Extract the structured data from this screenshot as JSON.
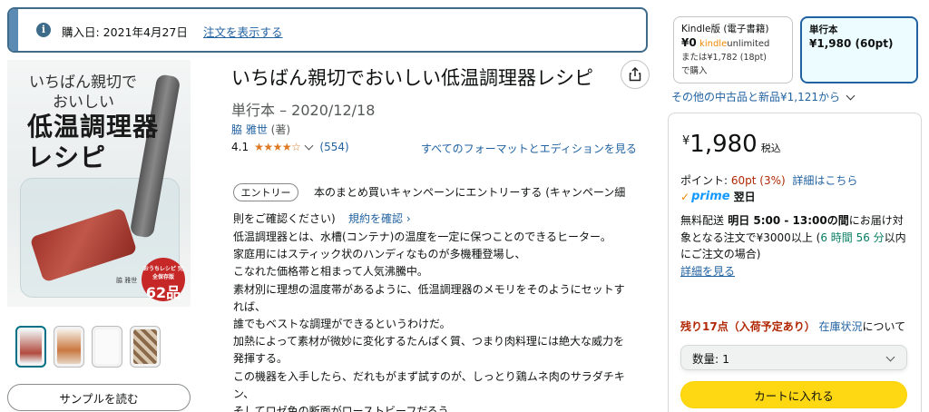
{
  "banner": {
    "purchase_date": "購入日: 2021年4月27日",
    "order_link": "注文を表示する"
  },
  "cover": {
    "line1": "いちばん親切で",
    "line2": "おいしい",
    "line3": "低温調理器",
    "line4": "レシピ",
    "author": "脇 雅世",
    "badge_small": "おうちレシピ 完全保存版",
    "badge_big": "62品"
  },
  "sample_button": "サンプルを読む",
  "product": {
    "title": "いちばん親切でおいしい低温調理器レシピ",
    "subtitle": "単行本 – 2020/12/18",
    "author_name": "脇 雅世",
    "author_role": " (著)",
    "rating": "4.1",
    "stars": "★★★★☆",
    "review_count": "(554)",
    "formats_link": "すべてのフォーマットとエディションを見る"
  },
  "campaign": {
    "entry_button": "エントリー",
    "text_line1": "本のまとめ買いキャンペーンにエントリーする (キャンペーン細",
    "text_line2": "則をご確認ください)",
    "terms_link": "規約を確認 ›"
  },
  "description": [
    "低温調理器とは、水槽(コンテナ)の温度を一定に保つことのできるヒーター。",
    "家庭用にはスティック状のハンディなものが多機種登場し、",
    "こなれた価格帯と相まって人気沸騰中。",
    "素材別に理想の温度帯があるように、低温調理器のメモリをそのようにセットす",
    "れば、",
    "誰でもベストな調理ができるというわけだ。",
    "加熱によって素材が微妙に変化するたんぱく質、つまり肉料理には絶大な威力を",
    "発揮する。",
    "この機器を入手したら、だれもがまず試すのが、しっとり鶏ムネ肉のサラダチキ",
    "ン、",
    "そしてロゼ色の断面がローストビーフだろう。"
  ],
  "formats": {
    "kindle_name": "Kindle版 (電子書籍)",
    "kindle_price": "¥0",
    "kindle_unlimited_brand": "kindle",
    "kindle_unlimited_suffix": "unlimited",
    "kindle_alt": "または¥1,782 (18pt)",
    "kindle_alt2": "で購入",
    "tankobon_name": "単行本",
    "tankobon_price": "¥1,980 (60pt)"
  },
  "used_link": "その他の中古品と新品¥1,121から",
  "buybox": {
    "yen": "¥",
    "price": "1,980",
    "tax": "税込",
    "points_label": "ポイント: ",
    "points_value": "60pt (3%)",
    "points_link": "詳細はこちら",
    "prime_word": "prime",
    "prime_day": "翌日",
    "delivery_free": "無料配送",
    "delivery_time": " 明日 5:00 - 13:00の間",
    "delivery_rest": "にお届け対象となる注文で¥3000以上 (",
    "delivery_countdown": "6 時間 56 分",
    "delivery_tail": "以内にご注文の場合)",
    "details_link": "詳細を見る",
    "stock_red": "残り17点（入荷予定あり）",
    "stock_link": "在庫状況",
    "stock_tail": "について",
    "qty_label": "数量: 1",
    "cart_button": "カートに入れる"
  }
}
